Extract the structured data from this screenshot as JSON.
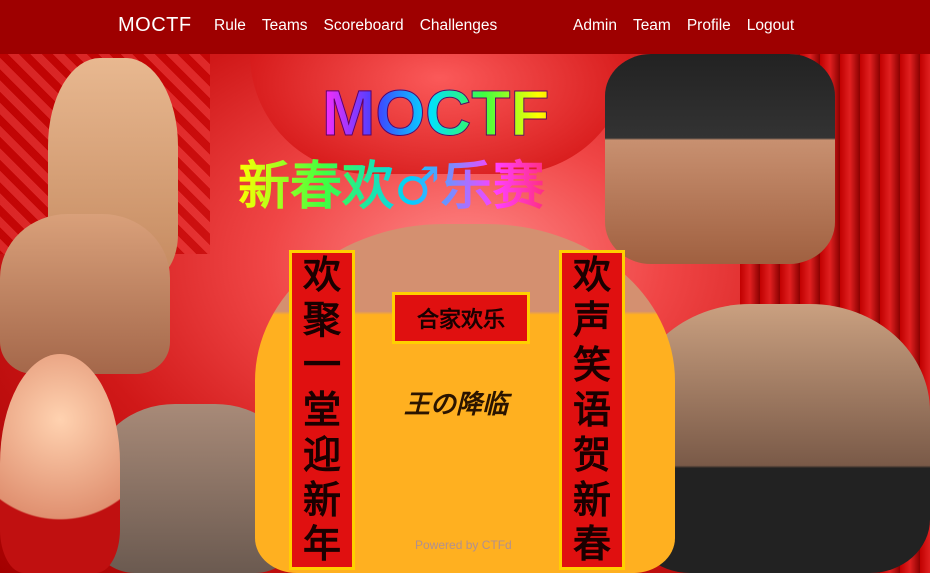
{
  "navbar": {
    "brand": "MOCTF",
    "left_links": [
      "Rule",
      "Teams",
      "Scoreboard",
      "Challenges"
    ],
    "right_links": [
      "Admin",
      "Team",
      "Profile",
      "Logout"
    ]
  },
  "banner": {
    "title_en": "MOCTF",
    "title_cn": "新春欢♂乐赛",
    "couplet_left": [
      "欢",
      "聚",
      "一",
      "堂",
      "迎",
      "新",
      "年"
    ],
    "couplet_right": [
      "欢",
      "声",
      "笑",
      "语",
      "贺",
      "新",
      "春"
    ],
    "center_banner": "合家欢乐",
    "shirt_text": "王の降临"
  },
  "footer": {
    "powered_by": "Powered by CTFd"
  },
  "colors": {
    "navbar_bg": "#9e0000",
    "banner_red": "#d01818",
    "couplet_red": "#e01010",
    "gold": "#ffd000"
  }
}
